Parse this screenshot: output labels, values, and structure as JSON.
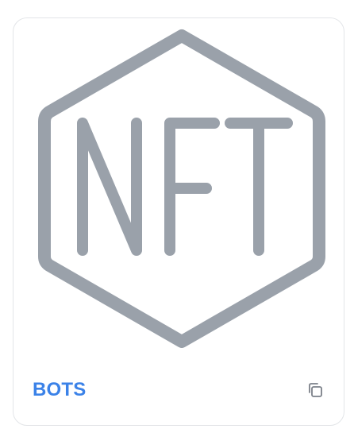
{
  "card": {
    "logo_icon": "nft-hexagon-icon",
    "logo_text": "NFT",
    "title": "BOTS",
    "copy_icon": "copy-icon"
  },
  "colors": {
    "logo": "#9aa1aa",
    "title": "#3b82e8",
    "icon": "#7b8089",
    "border": "#e3e5e8"
  }
}
